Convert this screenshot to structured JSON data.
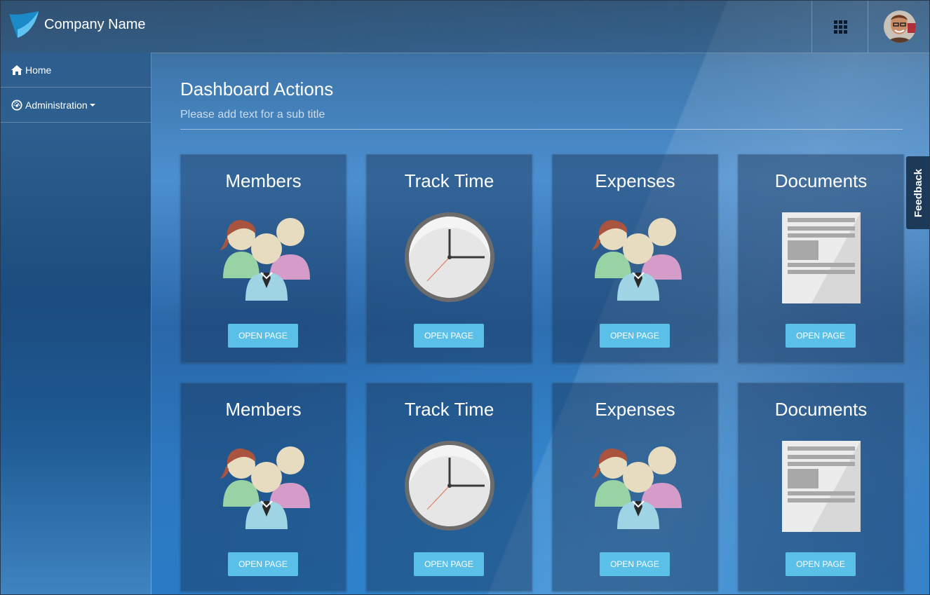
{
  "header": {
    "brand_name": "Company Name",
    "apps_icon": "grid-icon",
    "avatar": "user-avatar"
  },
  "sidebar": {
    "items": [
      {
        "label": "Home",
        "icon": "home-icon"
      },
      {
        "label": "Administration",
        "icon": "dashboard-icon",
        "has_dropdown": true
      }
    ]
  },
  "main": {
    "title": "Dashboard Actions",
    "subtitle": "Please add text for a sub title"
  },
  "cards": [
    {
      "title": "Members",
      "icon": "members-icon",
      "button": "OPEN PAGE"
    },
    {
      "title": "Track Time",
      "icon": "clock-icon",
      "button": "OPEN PAGE"
    },
    {
      "title": "Expenses",
      "icon": "members-icon",
      "button": "OPEN PAGE"
    },
    {
      "title": "Documents",
      "icon": "document-icon",
      "button": "OPEN PAGE"
    },
    {
      "title": "Members",
      "icon": "members-icon",
      "button": "OPEN PAGE"
    },
    {
      "title": "Track Time",
      "icon": "clock-icon",
      "button": "OPEN PAGE"
    },
    {
      "title": "Expenses",
      "icon": "members-icon",
      "button": "OPEN PAGE"
    },
    {
      "title": "Documents",
      "icon": "document-icon",
      "button": "OPEN PAGE"
    }
  ],
  "feedback": {
    "label": "Feedback"
  },
  "colors": {
    "button": "#5bc0e8",
    "card_background": "#163054",
    "sidebar": "#1b4c7f"
  }
}
